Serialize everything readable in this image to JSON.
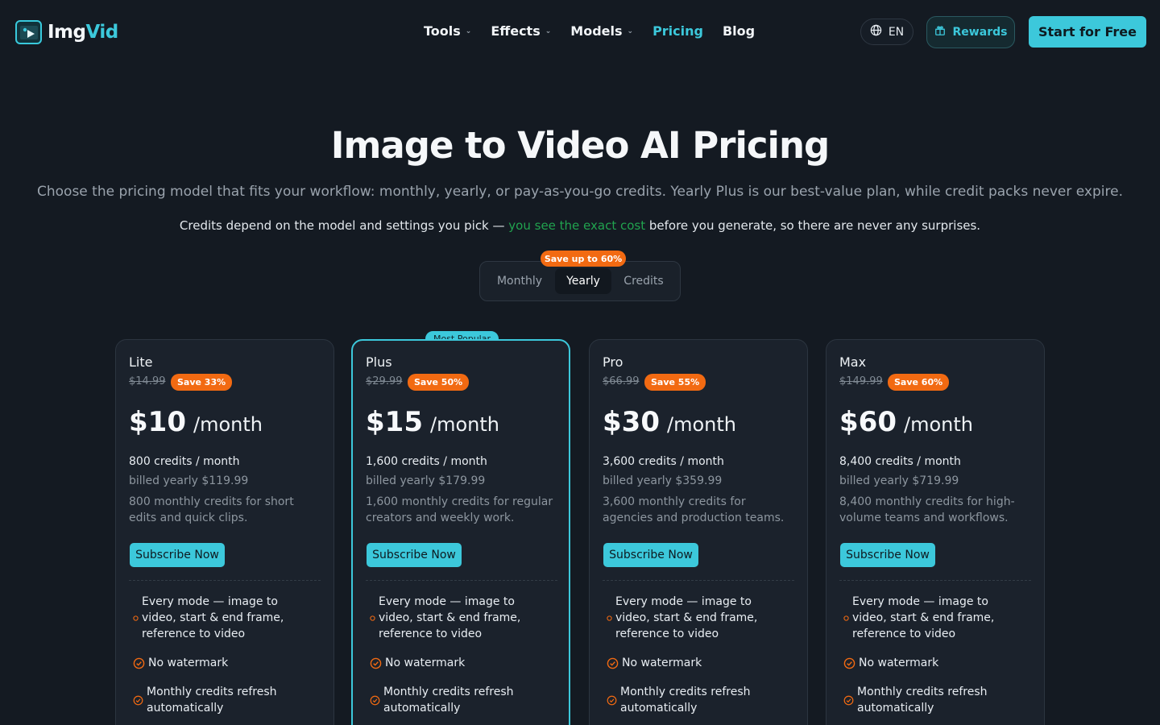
{
  "brand": {
    "name_part1": "Img",
    "name_part2": "Vid"
  },
  "nav": {
    "items": [
      {
        "label": "Tools",
        "dropdown": true,
        "active": false
      },
      {
        "label": "Effects",
        "dropdown": true,
        "active": false
      },
      {
        "label": "Models",
        "dropdown": true,
        "active": false
      },
      {
        "label": "Pricing",
        "dropdown": false,
        "active": true
      },
      {
        "label": "Blog",
        "dropdown": false,
        "active": false
      }
    ],
    "language": "EN",
    "rewards_label": "Rewards",
    "cta_label": "Start for Free"
  },
  "hero": {
    "title": "Image to Video AI Pricing",
    "subtitle": "Choose the pricing model that fits your workflow: monthly, yearly, or pay-as-you-go credits. Yearly Plus is our best-value plan, while credit packs never expire.",
    "note_before": "Credits depend on the model and settings you pick — ",
    "note_highlight": "you see the exact cost",
    "note_after": " before you generate, so there are never any surprises."
  },
  "billing_toggle": {
    "options": [
      "Monthly",
      "Yearly",
      "Credits"
    ],
    "selected": "Yearly",
    "save_badge": "Save up to 60%"
  },
  "popular_badge": "Most Popular",
  "plans": [
    {
      "name": "Lite",
      "old_price": "$14.99",
      "save": "Save 33%",
      "price": "$10",
      "per": "/month",
      "credits": "800 credits / month",
      "billed": "billed yearly $119.99",
      "description": "800 monthly credits for short edits and quick clips.",
      "button": "Subscribe Now",
      "features": [
        "Every mode — image to video, start & end frame, reference to video",
        "No watermark",
        "Monthly credits refresh automatically"
      ]
    },
    {
      "name": "Plus",
      "old_price": "$29.99",
      "save": "Save 50%",
      "price": "$15",
      "per": "/month",
      "credits": "1,600 credits / month",
      "billed": "billed yearly $179.99",
      "description": "1,600 monthly credits for regular creators and weekly work.",
      "button": "Subscribe Now",
      "features": [
        "Every mode — image to video, start & end frame, reference to video",
        "No watermark",
        "Monthly credits refresh automatically"
      ]
    },
    {
      "name": "Pro",
      "old_price": "$66.99",
      "save": "Save 55%",
      "price": "$30",
      "per": "/month",
      "credits": "3,600 credits / month",
      "billed": "billed yearly $359.99",
      "description": "3,600 monthly credits for agencies and production teams.",
      "button": "Subscribe Now",
      "features": [
        "Every mode — image to video, start & end frame, reference to video",
        "No watermark",
        "Monthly credits refresh automatically"
      ]
    },
    {
      "name": "Max",
      "old_price": "$149.99",
      "save": "Save 60%",
      "price": "$60",
      "per": "/month",
      "credits": "8,400 credits / month",
      "billed": "billed yearly $719.99",
      "description": "8,400 monthly credits for high-volume teams and workflows.",
      "button": "Subscribe Now",
      "features": [
        "Every mode — image to video, start & end frame, reference to video",
        "No watermark",
        "Monthly credits refresh automatically"
      ]
    }
  ],
  "colors": {
    "accent": "#3cc8db",
    "save_orange": "#f26a12",
    "highlight_green": "#21a34f",
    "background": "#141a22",
    "card": "#1b222c"
  },
  "icons": {
    "logo": "play-image-icon",
    "nav_dropdown": "chevron-down-icon",
    "language": "globe-icon",
    "rewards": "gift-icon",
    "feature_check": "check-circle-icon"
  }
}
